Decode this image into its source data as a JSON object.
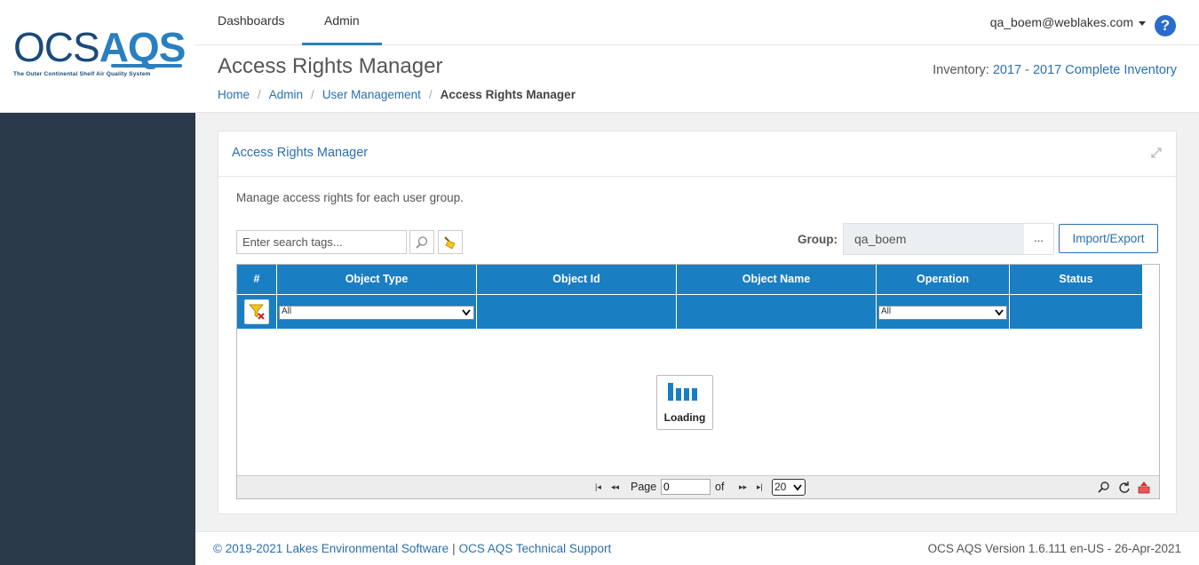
{
  "app": {
    "logo_main_left": "OCS",
    "logo_main_right": "AQS",
    "logo_tagline": "The Outer Continental Shelf Air Quality System"
  },
  "nav": {
    "tabs": [
      {
        "label": "Dashboards",
        "active": false
      },
      {
        "label": "Admin",
        "active": true
      }
    ],
    "user": "qa_boem@weblakes.com",
    "help_icon": "question-circle-icon"
  },
  "page": {
    "title": "Access Rights Manager",
    "breadcrumbs": [
      "Home",
      "Admin",
      "User Management",
      "Access Rights Manager"
    ],
    "inventory_label": "Inventory:",
    "inventory_value": "2017 - 2017 Complete Inventory"
  },
  "panel": {
    "title": "Access Rights Manager",
    "description": "Manage access rights for each user group.",
    "search_placeholder": "Enter search tags...",
    "group_label": "Group:",
    "group_value": "qa_boem",
    "group_more": "...",
    "import_export_label": "Import/Export"
  },
  "grid": {
    "columns": [
      "#",
      "Object Type",
      "Object Id",
      "Object Name",
      "Operation",
      "Status"
    ],
    "filters": {
      "object_type": "All",
      "operation": "All"
    },
    "loading_text": "Loading",
    "pager": {
      "page_label": "Page",
      "page_value": "0",
      "of_label": "of",
      "page_size": "20"
    }
  },
  "footer": {
    "copyright": "© 2019-2021 Lakes Environmental Software",
    "support_link": "OCS AQS Technical Support",
    "version": "OCS AQS Version 1.6.111 en-US - 26-Apr-2021"
  },
  "colors": {
    "sidebar": "#2b3a4a",
    "accent": "#2a6fb0",
    "grid_header": "#1a7ec2"
  }
}
